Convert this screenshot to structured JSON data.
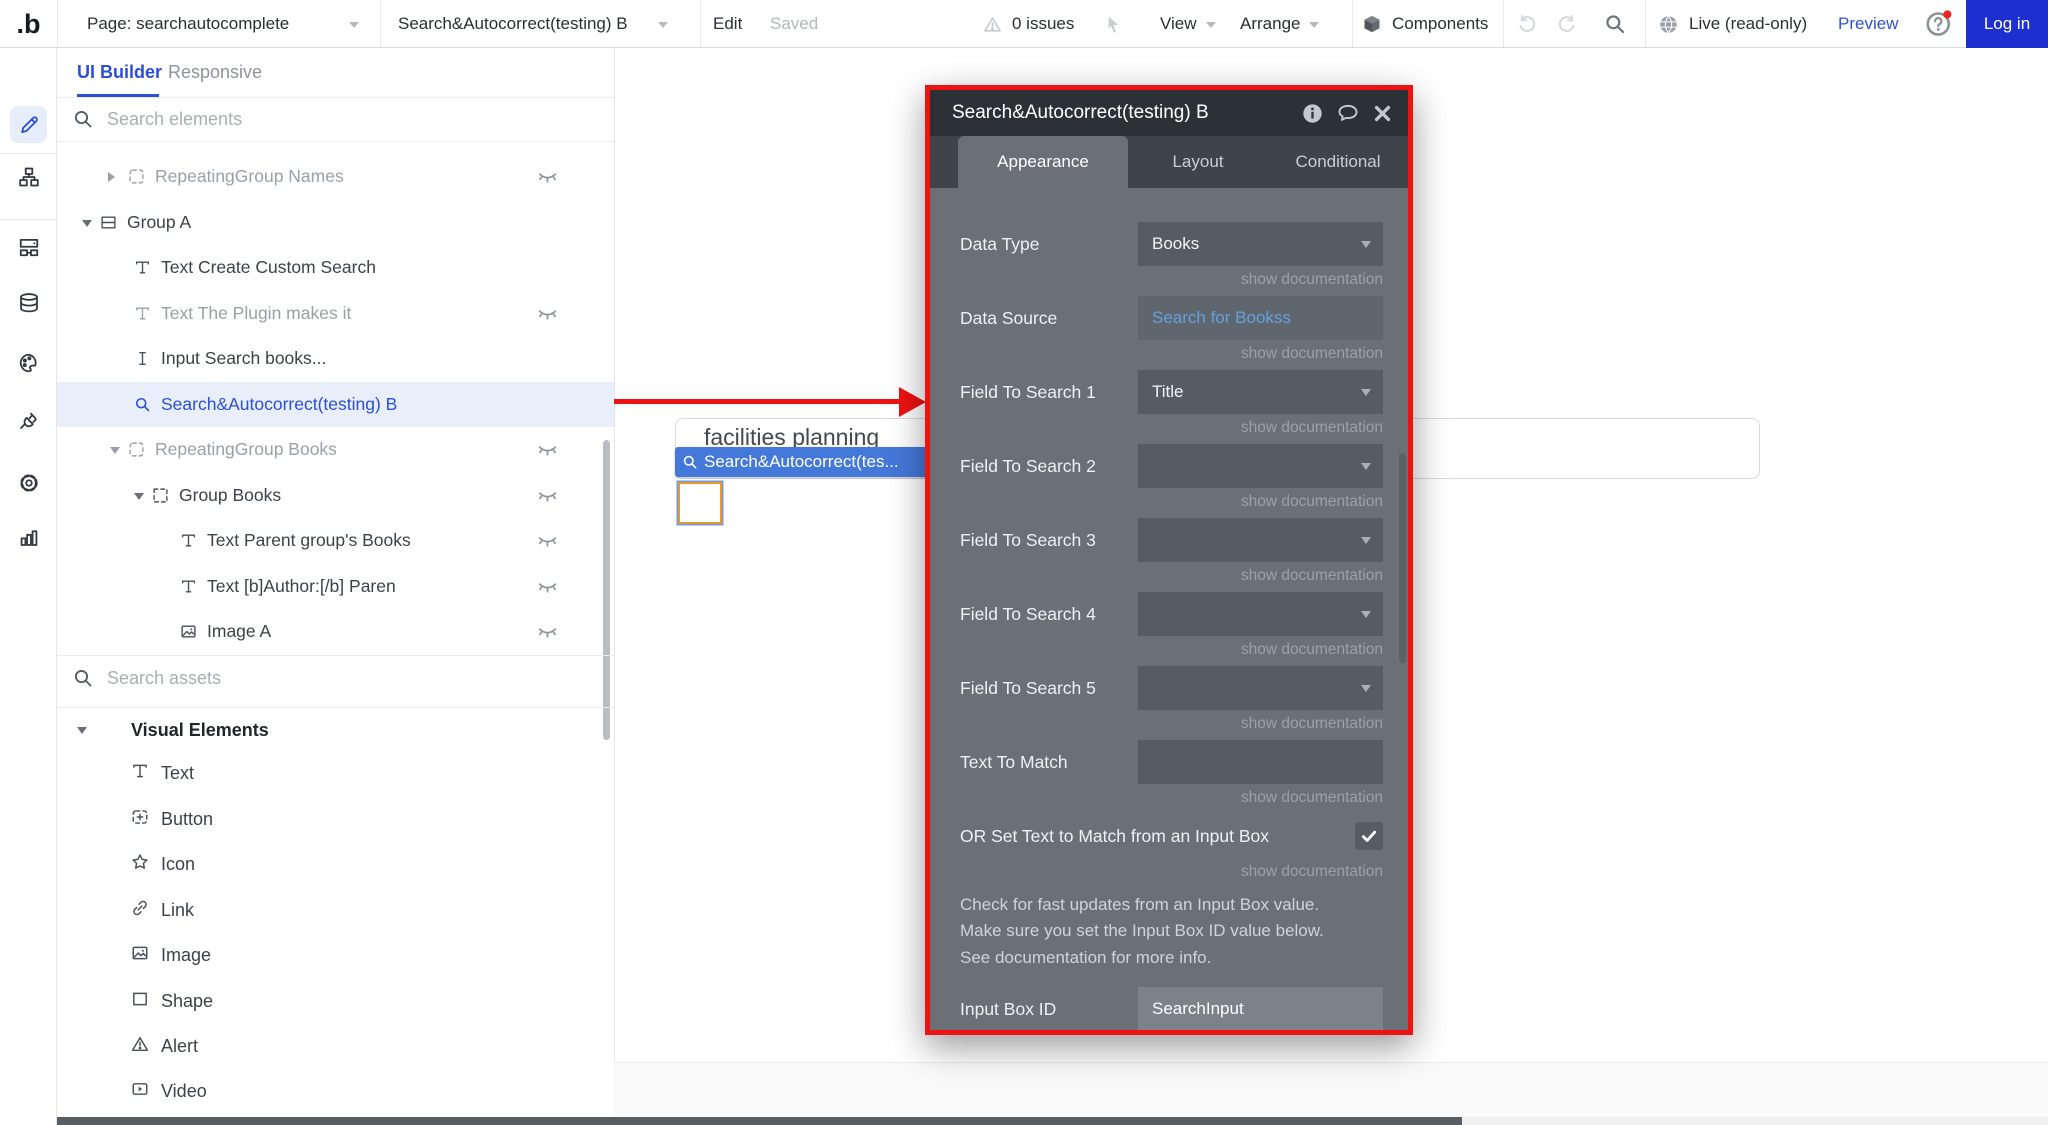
{
  "topbar": {
    "page_selector": "Page: searchautocomplete",
    "element_selector": "Search&Autocorrect(testing) B",
    "edit": "Edit",
    "saved": "Saved",
    "issues": "0 issues",
    "view": "View",
    "arrange": "Arrange",
    "components": "Components",
    "live": "Live (read-only)",
    "preview": "Preview",
    "login": "Log in",
    "login_bg": "#1e2fd2",
    "preview_color": "#2e53d8"
  },
  "iconbar": {
    "icons": [
      "design-pencil",
      "workflow",
      "wireframe",
      "database",
      "styles-palette",
      "plugins-plug",
      "settings-gear",
      "logs-chart"
    ],
    "active": "design-pencil",
    "active_color": "#2b4fd8"
  },
  "sidebar": {
    "tabs": {
      "ui_builder": "UI Builder",
      "responsive": "Responsive"
    },
    "search_elements_placeholder": "Search elements",
    "search_assets_placeholder": "Search assets",
    "tree": [
      {
        "label": "RepeatingGroup Names",
        "icon": "repeating-group-icon",
        "expand": "right",
        "muted": true,
        "hidden_eye": true
      },
      {
        "label": "Group A",
        "icon": "group-rows-icon",
        "expand": "down",
        "muted": false,
        "hidden_eye": false
      },
      {
        "label": "Text Create Custom Search",
        "icon": "text-icon",
        "expand": "none",
        "muted": false,
        "hidden_eye": false
      },
      {
        "label": "Text The Plugin makes it",
        "icon": "text-icon",
        "expand": "none",
        "muted": true,
        "hidden_eye": true
      },
      {
        "label": "Input Search books...",
        "icon": "input-icon",
        "expand": "none",
        "muted": false,
        "hidden_eye": false
      },
      {
        "label": "Search&Autocorrect(testing) B",
        "icon": "search-icon",
        "expand": "none",
        "muted": false,
        "selected": true,
        "hidden_eye": false
      },
      {
        "label": "RepeatingGroup Books",
        "icon": "repeating-group-icon",
        "expand": "down",
        "muted": true,
        "hidden_eye": true
      },
      {
        "label": "Group Books",
        "icon": "group-dashed-icon",
        "expand": "down",
        "muted": false,
        "hidden_eye": true
      },
      {
        "label": "Text Parent group's Books",
        "icon": "text-icon",
        "expand": "none",
        "muted": false,
        "hidden_eye": true
      },
      {
        "label": "Text [b]Author:[/b] Paren",
        "icon": "text-icon",
        "expand": "none",
        "muted": false,
        "hidden_eye": true
      },
      {
        "label": "Image A",
        "icon": "image-icon",
        "expand": "none",
        "muted": false,
        "hidden_eye": true
      }
    ],
    "visual_elements": {
      "header": "Visual Elements",
      "items": [
        {
          "label": "Text",
          "icon": "text-icon"
        },
        {
          "label": "Button",
          "icon": "button-icon"
        },
        {
          "label": "Icon",
          "icon": "star-icon"
        },
        {
          "label": "Link",
          "icon": "link-icon"
        },
        {
          "label": "Image",
          "icon": "image-icon"
        },
        {
          "label": "Shape",
          "icon": "shape-icon"
        },
        {
          "label": "Alert",
          "icon": "alert-icon"
        },
        {
          "label": "Video",
          "icon": "video-icon"
        }
      ]
    }
  },
  "canvas": {
    "input_text": "facilities planning",
    "element_label": "Search&Autocorrect(tes...",
    "label_bg": "#4478d9",
    "selection_border": "#e8962e"
  },
  "popup": {
    "title": "Search&Autocorrect(testing) B",
    "border_color": "#ee1212",
    "link_color": "#64a0e0",
    "tabs": [
      {
        "label": "Appearance",
        "active": true
      },
      {
        "label": "Layout",
        "active": false
      },
      {
        "label": "Conditional",
        "active": false
      }
    ],
    "show_documentation": "show documentation",
    "fields": [
      {
        "label": "Data Type",
        "type": "dropdown",
        "value": "Books"
      },
      {
        "label": "Data Source",
        "type": "link",
        "value": "Search for Bookss"
      },
      {
        "label": "Field To Search 1",
        "type": "dropdown",
        "value": "Title"
      },
      {
        "label": "Field To Search 2",
        "type": "dropdown",
        "value": ""
      },
      {
        "label": "Field To Search 3",
        "type": "dropdown",
        "value": ""
      },
      {
        "label": "Field To Search 4",
        "type": "dropdown",
        "value": ""
      },
      {
        "label": "Field To Search 5",
        "type": "dropdown",
        "value": ""
      },
      {
        "label": "Text To Match",
        "type": "input",
        "value": ""
      },
      {
        "label": "OR Set Text to Match from an Input Box",
        "type": "checkbox",
        "checked": true
      }
    ],
    "note": "Check for fast updates from an Input Box value. Make sure you set the Input Box ID value below. See documentation for more info.",
    "input_box_id": {
      "label": "Input Box ID",
      "value": "SearchInput"
    }
  }
}
